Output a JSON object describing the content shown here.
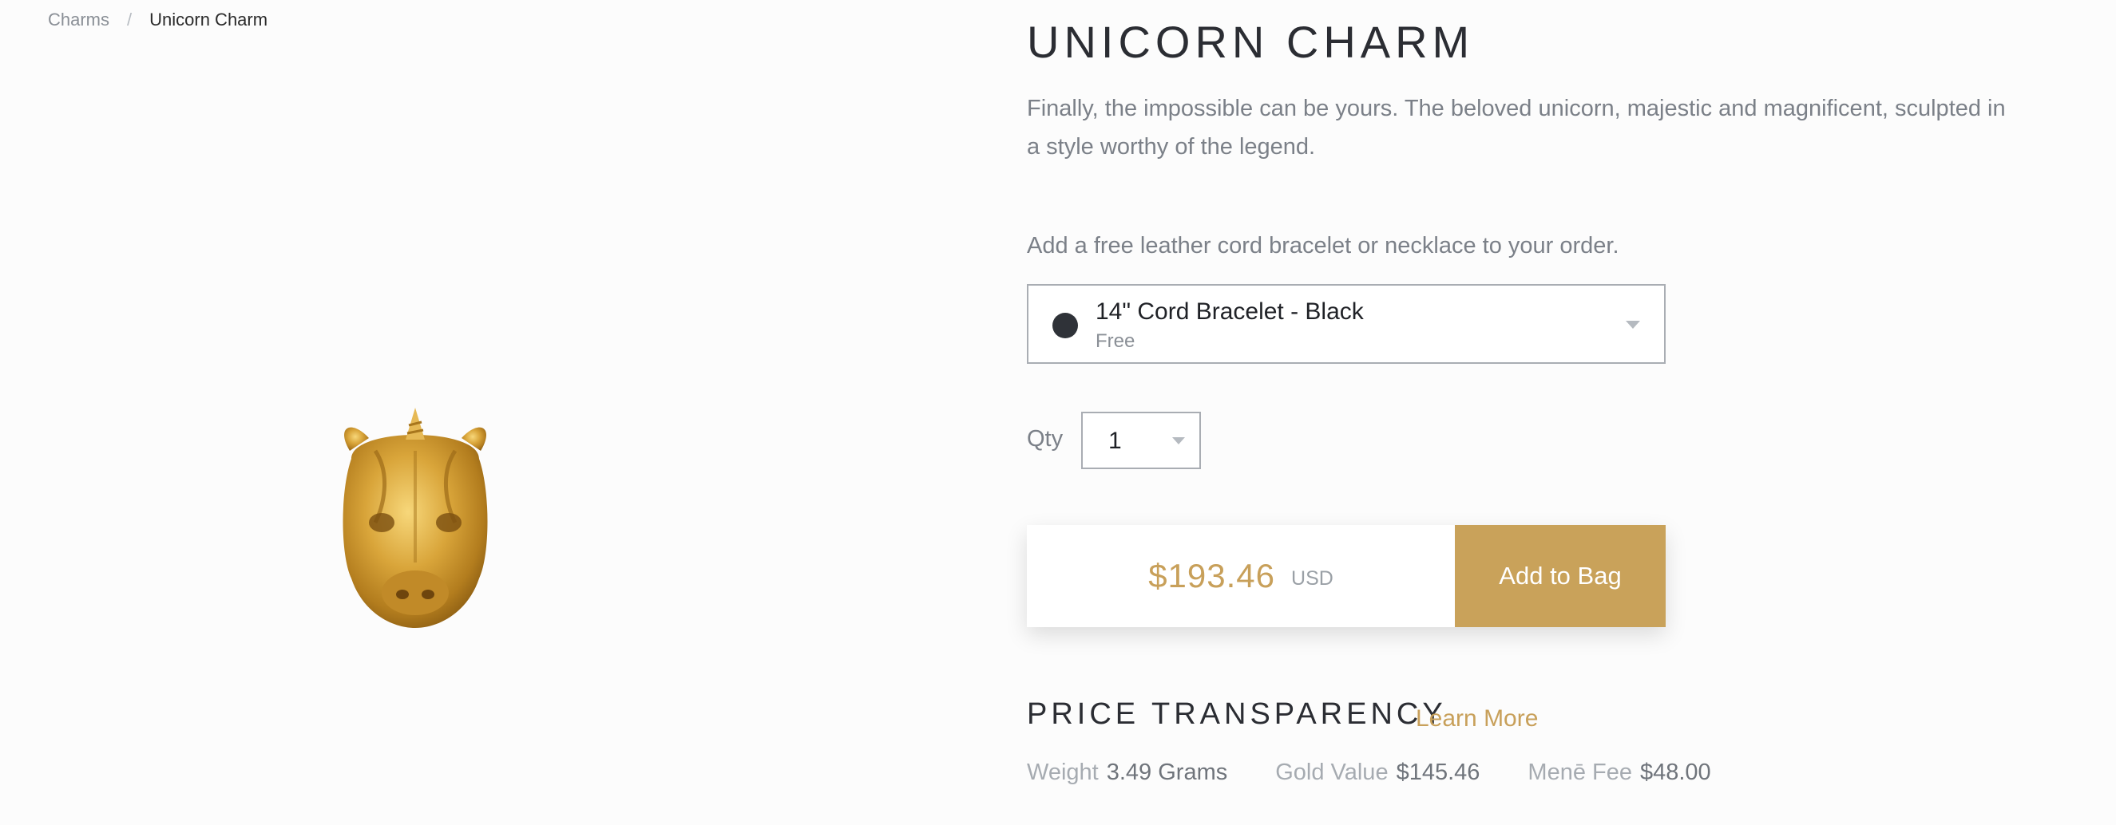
{
  "breadcrumb": {
    "parent": "Charms",
    "separator": "/",
    "current": "Unicorn Charm"
  },
  "product": {
    "title": "UNICORN CHARM",
    "description": "Finally, the impossible can be yours. The beloved unicorn, majestic and magnificent, sculpted in a style worthy of the legend.",
    "image_icon": "unicorn-head-gold-charm"
  },
  "addon": {
    "prompt": "Add a free leather cord bracelet or necklace to your order.",
    "selected_name": "14\" Cord Bracelet - Black",
    "selected_price": "Free",
    "swatch_color": "#2f3238"
  },
  "quantity": {
    "label": "Qty",
    "value": "1"
  },
  "purchase": {
    "price": "$193.46",
    "currency": "USD",
    "button_label": "Add to Bag",
    "accent_color": "#c9a25a"
  },
  "transparency": {
    "title": "PRICE TRANSPARENCY",
    "learn_more": "Learn More",
    "stats": [
      {
        "label": "Weight",
        "value": "3.49 Grams"
      },
      {
        "label": "Gold Value",
        "value": "$145.46"
      },
      {
        "label": "Menē Fee",
        "value": "$48.00"
      }
    ]
  }
}
